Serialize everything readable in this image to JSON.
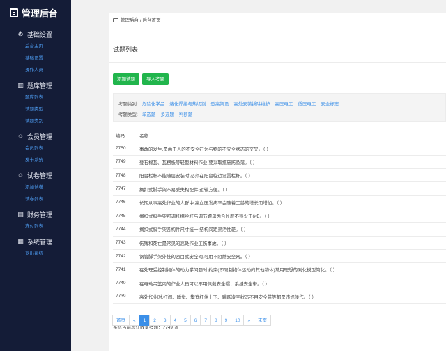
{
  "sidebar": {
    "brand": "管理后台",
    "groups": [
      {
        "title": "基础设置",
        "icon": "gear-icon",
        "glyph": "⚙",
        "items": [
          "后台主页",
          "基础设置",
          "操作人员"
        ]
      },
      {
        "title": "题库管理",
        "icon": "books-icon",
        "glyph": "▥",
        "items": [
          "题库列表",
          "试题类型",
          "试题类别"
        ]
      },
      {
        "title": "会员管理",
        "icon": "user-icon",
        "glyph": "☺",
        "items": [
          "会员列表",
          "发卡系统"
        ]
      },
      {
        "title": "试卷管理",
        "icon": "user-icon",
        "glyph": "☺",
        "items": [
          "添加试卷",
          "试卷列表"
        ]
      },
      {
        "title": "财务管理",
        "icon": "card-icon",
        "glyph": "▤",
        "items": [
          "支付列表"
        ]
      },
      {
        "title": "系统管理",
        "icon": "system-icon",
        "glyph": "▦",
        "items": [
          "退出系统"
        ]
      }
    ]
  },
  "breadcrumb": {
    "root": "管理后台",
    "sep": "/",
    "current": "后台首页"
  },
  "page_title": "试题列表",
  "buttons": {
    "add": "添加试题",
    "import": "导入考题"
  },
  "filters": {
    "category_label": "考题类别:",
    "categories": [
      "危险化学品",
      "熔化焊接与热切割",
      "登高架设",
      "高处安装拆除维护",
      "高压电工",
      "低压电工",
      "安全标志"
    ],
    "type_label": "考题类型:",
    "types": [
      "单选题",
      "多选题",
      "判断题"
    ]
  },
  "table": {
    "headers": [
      "编码",
      "名称"
    ],
    "rows": [
      [
        "7750",
        "事故的发生,是由于人的不安全行为与物的不安全状态的交叉。（ ）"
      ],
      [
        "7749",
        "登石棉瓦、瓦楞板等轻型材料作业,要采取措施防坠落。（ ）"
      ],
      [
        "7748",
        "阳台栏杆不能随层安装时,必须在阳台临边设置栏杆。（ ）"
      ],
      [
        "7747",
        "搁扣式脚手架不易丢失构配件,运输方便。（ ）"
      ],
      [
        "7746",
        "长期从事高处作业的人群中,高血压发病率会随着工龄的增长而增加。（ ）"
      ],
      [
        "7745",
        "搁扣式脚手架可调托撑丝杆与调节螺母齿合长度不得少于6扣。（ ）"
      ],
      [
        "7744",
        "搁扣式脚手架各构件尺寸统一,结构间距灵活性差。（ ）"
      ],
      [
        "7743",
        "伤残和死亡是常见的高处作业工伤事故。（ ）"
      ],
      [
        "7742",
        "钢管脚手架外挂的密目式安全网,可用不阻燃安全网。（ ）"
      ],
      [
        "7741",
        "在处理受控制物体的动力学问题时,约束(即限制物体运动的其他物体)常用理想的刚化模型简化。（ ）"
      ],
      [
        "7740",
        "在电动吊篮内的作业人员可以不用佩戴安全帽、系挂安全带。（ ）"
      ],
      [
        "7739",
        "高处作业时,打闹、睡觉、攀登杆件上下、跳跃凌空状态不用安全带等都是违规操作。（ ）"
      ]
    ]
  },
  "total_text": "系统当前总计收录考题：7749 道",
  "pagination": [
    "首页",
    "«",
    "1",
    "2",
    "3",
    "4",
    "5",
    "6",
    "7",
    "8",
    "9",
    "10",
    "»",
    "末页"
  ],
  "pagination_current": "1"
}
